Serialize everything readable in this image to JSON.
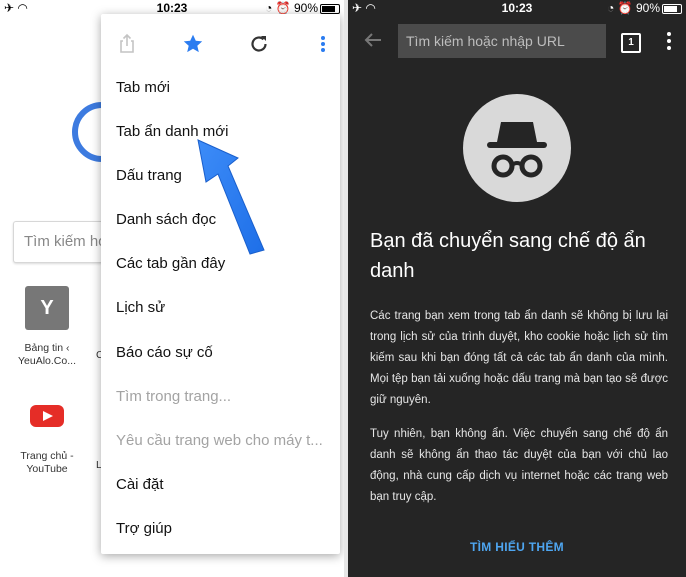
{
  "left": {
    "status": {
      "time": "10:23",
      "battery": "90%"
    },
    "background_page": {
      "search_placeholder": "Tìm kiếm ho",
      "tiles": [
        {
          "letter": "Y",
          "caption_line1": "Bảng tin ‹",
          "caption_line2": "YeuAlo.Co..."
        },
        {
          "caption_line1": "Trang chủ -",
          "caption_line2": "YouTube"
        }
      ],
      "peek_c": "C",
      "peek_l": "L"
    },
    "menu": {
      "icons": [
        "share-icon",
        "star-icon",
        "reload-icon",
        "more-vert-icon"
      ],
      "items": [
        {
          "label": "Tab mới",
          "enabled": true
        },
        {
          "label": "Tab ẩn danh mới",
          "enabled": true
        },
        {
          "label": "Dấu trang",
          "enabled": true
        },
        {
          "label": "Danh sách đọc",
          "enabled": true
        },
        {
          "label": "Các tab gần đây",
          "enabled": true
        },
        {
          "label": "Lịch sử",
          "enabled": true
        },
        {
          "label": "Báo cáo sự cố",
          "enabled": true
        },
        {
          "label": "Tìm trong trang...",
          "enabled": false
        },
        {
          "label": "Yêu cầu trang web cho máy t...",
          "enabled": false
        },
        {
          "label": "Cài đặt",
          "enabled": true
        },
        {
          "label": "Trợ giúp",
          "enabled": true
        }
      ]
    },
    "accent_color": "#2b7cf0"
  },
  "right": {
    "status": {
      "time": "10:23",
      "battery": "90%"
    },
    "omnibox_placeholder": "Tìm kiếm hoặc nhập URL",
    "tab_count": "1",
    "title": "Bạn đã chuyển sang chế độ ẩn danh",
    "paragraph1": "Các trang bạn xem trong tab ẩn danh sẽ không bị lưu lại trong lịch sử của trình duyệt, kho cookie hoặc lịch sử tìm kiếm sau khi bạn đóng tất cả các tab ẩn danh của mình. Mọi tệp bạn tải xuống hoặc dấu trang mà bạn tạo sẽ được giữ nguyên.",
    "paragraph2": "Tuy nhiên, bạn không ẩn. Việc chuyển sang chế độ ẩn danh sẽ không ẩn thao tác duyệt của bạn với chủ lao động, nhà cung cấp dịch vụ internet hoặc các trang web bạn truy cập.",
    "learn_more": "TÌM HIỂU THÊM",
    "link_color": "#4ea6f1",
    "background_color": "#252525"
  }
}
